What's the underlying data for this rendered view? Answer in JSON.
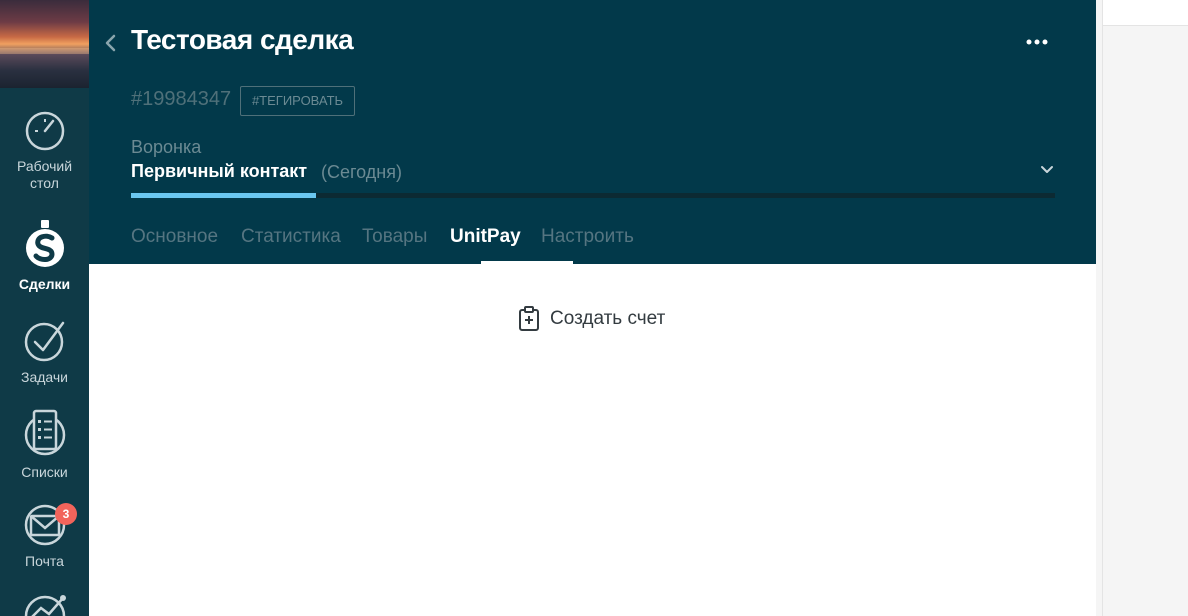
{
  "sidebar": {
    "items": [
      {
        "label_line1": "Рабочий",
        "label_line2": "стол",
        "icon": "dashboard-icon"
      },
      {
        "label": "Сделки",
        "icon": "deals-icon",
        "active": true
      },
      {
        "label": "Задачи",
        "icon": "tasks-icon"
      },
      {
        "label": "Списки",
        "icon": "lists-icon"
      },
      {
        "label": "Почта",
        "icon": "mail-icon",
        "badge": "3"
      }
    ]
  },
  "header": {
    "title": "Тестовая сделка",
    "deal_id": "#19984347",
    "tag_button": "#ТЕГИРОВАТЬ",
    "funnel_label": "Воронка",
    "stage": "Первичный контакт",
    "stage_date": "(Сегодня)",
    "stage_progress": 0.2
  },
  "tabs": [
    {
      "label": "Основное"
    },
    {
      "label": "Статистика"
    },
    {
      "label": "Товары"
    },
    {
      "label": "UnitPay",
      "active": true
    },
    {
      "label": "Настроить"
    }
  ],
  "content": {
    "create_invoice_label": "Создать счет"
  },
  "colors": {
    "sidebar_bg": "#0f3a47",
    "header_bg": "#02394a",
    "progress_fill": "#6bc7f0",
    "badge": "#f2645b"
  }
}
